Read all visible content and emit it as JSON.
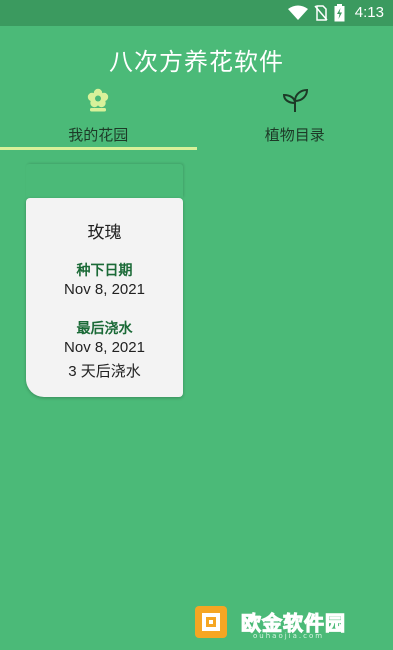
{
  "status_bar": {
    "time": "4:13",
    "icons": [
      "wifi-icon",
      "no-sim-icon",
      "battery-charging-icon"
    ],
    "background": "#3b9a5f"
  },
  "app": {
    "title": "八次方养花软件",
    "background": "#4bba78",
    "accent": "#d8f19a"
  },
  "tabs": [
    {
      "label": "我的花园",
      "icon": "flower-icon",
      "selected": true
    },
    {
      "label": "植物目录",
      "icon": "sprout-icon",
      "selected": false
    }
  ],
  "plants": [
    {
      "name": "玫瑰",
      "planted_label": "种下日期",
      "planted_date": "Nov 8, 2021",
      "watered_label": "最后浇水",
      "watered_date": "Nov 8, 2021",
      "next_water": "3 天后浇水"
    }
  ],
  "watermark": {
    "text": "欧金软件园",
    "url": "ouhaojia.com"
  }
}
